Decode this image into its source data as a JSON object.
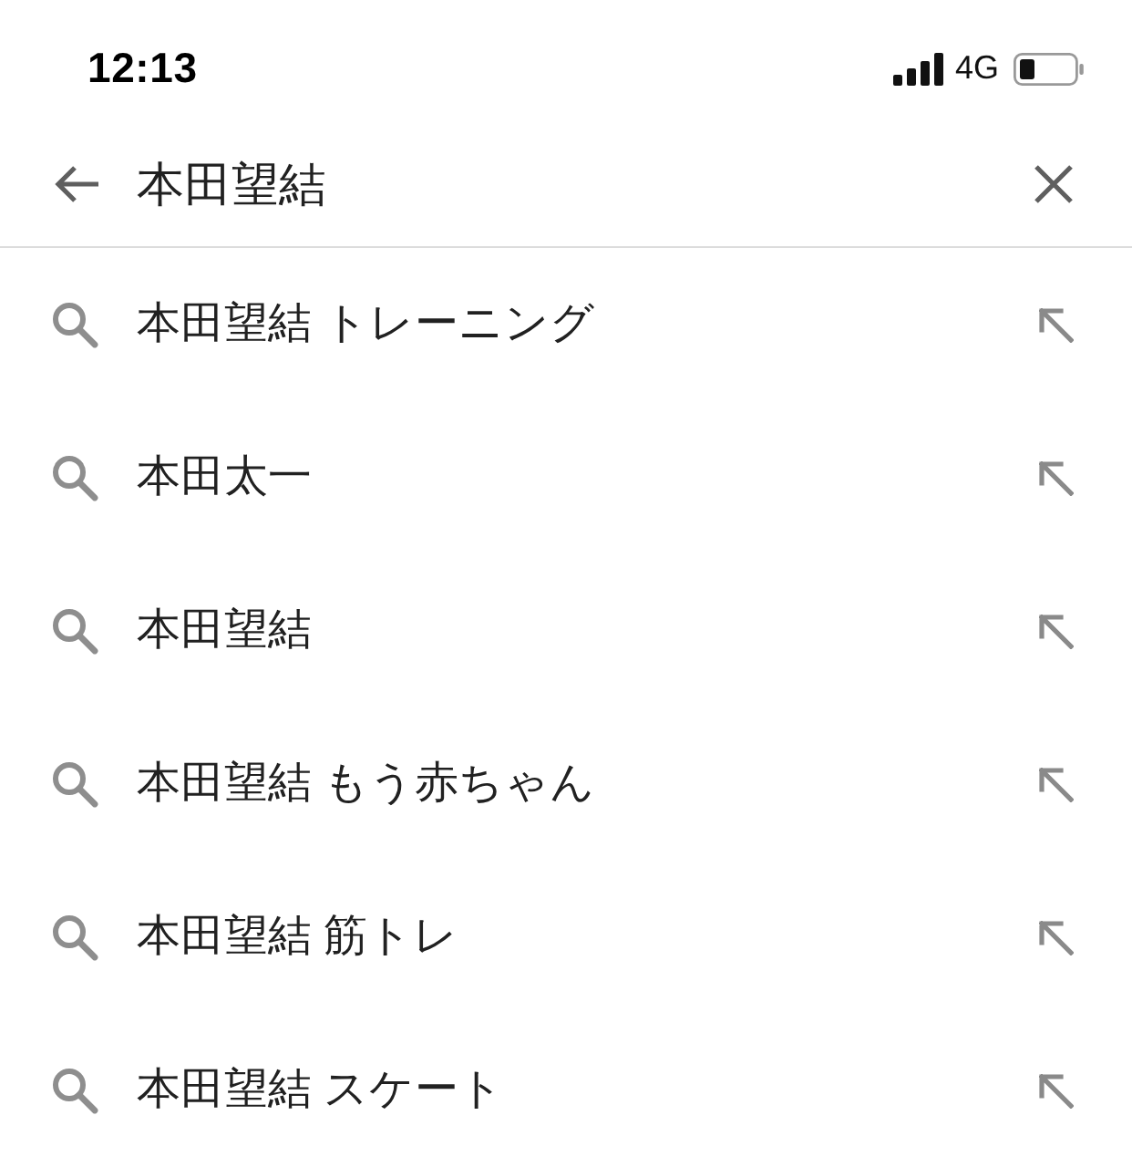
{
  "status_bar": {
    "time": "12:13",
    "network": "4G"
  },
  "search": {
    "value": "本田望結"
  },
  "suggestions": [
    {
      "text": "本田望結 トレーニング"
    },
    {
      "text": "本田太一"
    },
    {
      "text": "本田望結"
    },
    {
      "text": "本田望結 もう赤ちゃん"
    },
    {
      "text": "本田望結 筋トレ"
    },
    {
      "text": "本田望結 スケート"
    }
  ]
}
